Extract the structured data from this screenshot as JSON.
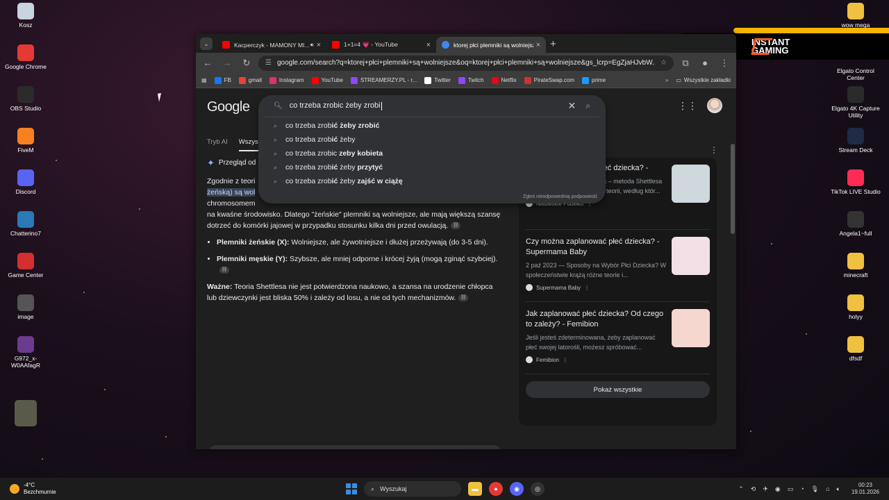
{
  "desktop": {
    "left_icons": [
      {
        "label": "Kosz",
        "icon": "recycle-bin-icon",
        "color": "#c8d4e0"
      },
      {
        "label": "Google Chrome",
        "icon": "chrome-icon",
        "color": "#e53935"
      },
      {
        "label": "OBS Studio",
        "icon": "obs-icon",
        "color": "#2b2b2b"
      },
      {
        "label": "FiveM",
        "icon": "fivem-icon",
        "color": "#f5821f"
      },
      {
        "label": "Discord",
        "icon": "discord-icon",
        "color": "#5865f2"
      },
      {
        "label": "Chatterino7",
        "icon": "chatterino-icon",
        "color": "#2a7ab9"
      },
      {
        "label": "Game Center",
        "icon": "game-center-icon",
        "color": "#d32f2f"
      },
      {
        "label": "image",
        "icon": "image-file-icon",
        "color": "#555555"
      },
      {
        "label": "G972_x-W0AAfagR",
        "icon": "image-file-icon",
        "color": "#6a3b8f"
      },
      {
        "label": "",
        "icon": "character-image-icon",
        "color": "#5a5a4a"
      }
    ],
    "right_icons": [
      {
        "label": "wow mega",
        "icon": "folder-icon",
        "color": "#f0c040"
      },
      {
        "label": "Elgato Control Center",
        "icon": "elgato-icon",
        "color": "#1a1a1a"
      },
      {
        "label": "Elgato 4K Capture Utility",
        "icon": "elgato-4k-icon",
        "color": "#2a2a2a"
      },
      {
        "label": "Stream Deck",
        "icon": "stream-deck-icon",
        "color": "#1f2a44"
      },
      {
        "label": "TikTok LIVE Studio",
        "icon": "tiktok-icon",
        "color": "#fe2c55"
      },
      {
        "label": "Angela1~full",
        "icon": "file-icon",
        "color": "#333333"
      },
      {
        "label": "minecraft",
        "icon": "folder-icon",
        "color": "#f0c040"
      },
      {
        "label": "holyy",
        "icon": "folder-icon",
        "color": "#f0c040"
      },
      {
        "label": "dfsdf",
        "icon": "folder-icon",
        "color": "#f0c040"
      }
    ],
    "overlay": {
      "line1": "INSTANT",
      "line2": "GAMING"
    }
  },
  "browser": {
    "tabs": [
      {
        "title": "Kacperczyk - MAMONY MI...",
        "favicon_color": "#ff0000",
        "active": false,
        "audio": true
      },
      {
        "title": "1+1=4 💗 - YouTube",
        "favicon_color": "#ff0000",
        "active": false,
        "audio": false
      },
      {
        "title": "ktorej płci plemniki są wolniejsze",
        "favicon_color": "#4285f4",
        "active": true,
        "audio": false
      }
    ],
    "url": "google.com/search?q=ktorej+płci+plemniki+są+wolniejsze&oq=ktorej+płci+plemniki+są+wolniejsze&gs_lcrp=EgZjaHJvbW...",
    "bookmarks": [
      {
        "label": "FB",
        "color": "#1877f2"
      },
      {
        "label": "gmail",
        "color": "#ea4335"
      },
      {
        "label": "Instagram",
        "color": "#e1306c"
      },
      {
        "label": "YouTube",
        "color": "#ff0000"
      },
      {
        "label": "STREAMERZY.PL - r...",
        "color": "#9146ff"
      },
      {
        "label": "Twitter",
        "color": "#ffffff"
      },
      {
        "label": "Twitch",
        "color": "#9146ff"
      },
      {
        "label": "Netflix",
        "color": "#e50914"
      },
      {
        "label": "PirateSwap.com",
        "color": "#cc3333"
      },
      {
        "label": "prime",
        "color": "#1a98ff"
      }
    ],
    "all_bookmarks": "Wszystkie zakładki"
  },
  "google": {
    "logo": "Google",
    "query": "co trzeba zrobic żeby zrobi",
    "suggestions": [
      {
        "pre": "co trzeba zrob",
        "bold": "ić żeby zrob",
        "post": "",
        "tail": "ić"
      },
      {
        "pre": "co trzeba zrob",
        "bold": "ić",
        "post": " żeby",
        "tail": ""
      },
      {
        "pre": "co trzeba zrobic ",
        "bold": "zeby kobieta",
        "post": "",
        "tail": ""
      },
      {
        "pre": "co trzeba zrob",
        "bold": "ić",
        "post": " żeby ",
        "tail": "przytyć"
      },
      {
        "pre": "co trzeba zrob",
        "bold": "ić",
        "post": " żeby ",
        "tail": "zajść w ciążę"
      }
    ],
    "report": "Zgłoś nieodpowiednią podpowiedź",
    "tabs": [
      "Tryb AI",
      "Wszys"
    ],
    "aio_title": "Przegląd od",
    "aio_p1a": "Zgodnie z teori",
    "aio_p1_hl": "żeńską) są wol",
    "aio_p1b": "chromosomem",
    "aio_p1c": "na kwaśne środowisko. Dlatego \"żeńskie\" plemniki są wolniejsze, ale mają większą szansę dotrzeć do komórki jajowej w przypadku stosunku kilka dni przed owulacją.",
    "bullet1_b": "Plemniki żeńskie (X):",
    "bullet1": " Wolniejsze, ale żywotniejsze i dłużej przeżywają (do 3-5 dni).",
    "bullet2_b": "Plemniki męskie (Y):",
    "bullet2": " Szybsze, ale mniej odporne i krócej żyją (mogą zginąć szybciej).",
    "note_b": "Ważne:",
    "note": " Teoria Shettlesa nie jest potwierdzona naukowo, a szansa na urodzenie chłopca lub dziewczynki jest bliska 50% i zależy od losu, a nie od tych mechanizmów.",
    "cards": [
      {
        "title": "...łeć dziecka? -",
        "snippet": "Jak zaplanować płeć dziecka – metoda Shettlesa Doktor Shettles jest autorem teorii, według któr...",
        "source": "Niebieskie Pudełko",
        "thumb": "#cfd8dc"
      },
      {
        "title": "Czy można zaplanować płeć dziecka? - Supermama Baby",
        "snippet": "2 paź 2023 — Sposoby na Wybór Płci Dziecka? W społeczeństwie krążą różne teorie i...",
        "source": "Supermama Baby",
        "thumb": "#f3e0e6"
      },
      {
        "title": "Jak zaplanować płeć dziecka? Od czego to zależy? - Femibion",
        "snippet": "Jeśli jesteś zdeterminowana, żeby zaplanować płeć swojej latorośli, możesz spróbować...",
        "source": "Femibion",
        "thumb": "#f6d7cf"
      }
    ],
    "show_all": "Pokaż wszystkie"
  },
  "taskbar": {
    "temp": "-4°C",
    "weather": "Bezchmurnie",
    "search_placeholder": "Wyszukaj",
    "time": "00:23",
    "date": "19.01.2026"
  }
}
